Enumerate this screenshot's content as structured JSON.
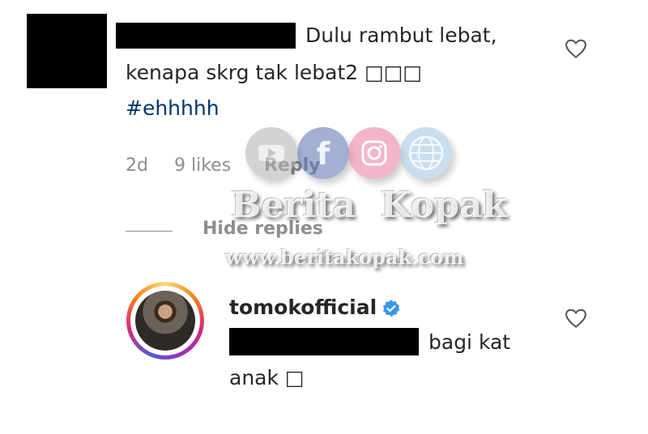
{
  "comment": {
    "text_line1": "Dulu rambut lebat,",
    "text_line2": "kenapa skrg tak lebat2 □□□",
    "hashtag": "#ehhhhh",
    "age": "2d",
    "likes": "9 likes",
    "reply": "Reply",
    "hide_replies": "Hide replies"
  },
  "reply_comment": {
    "username": "tomokofficial",
    "text_part": "bagi kat",
    "text_line2": "anak □"
  },
  "watermark": {
    "brand": "Berita  Kopak",
    "url": "www.beritakopak.com"
  },
  "icons": [
    "heart-outline-icon",
    "verified-badge-icon",
    "youtube-icon",
    "facebook-icon",
    "instagram-icon",
    "globe-icon"
  ]
}
